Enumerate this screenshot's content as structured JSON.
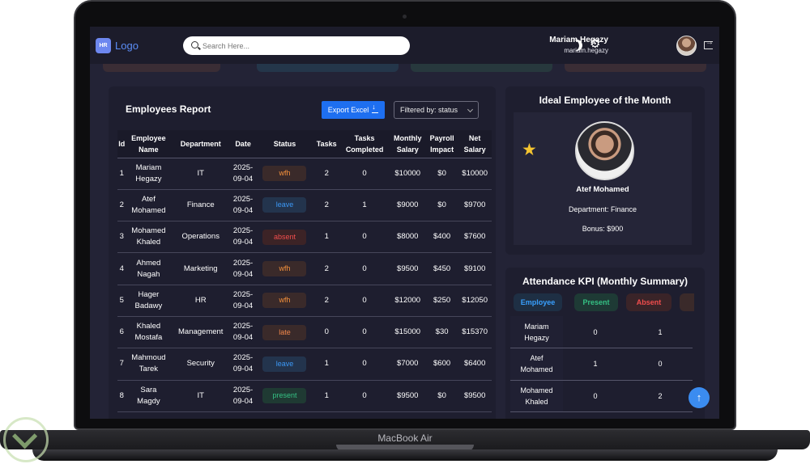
{
  "app": {
    "logo_badge": "HR",
    "logo_text": "Logo",
    "search_placeholder": "Search Here...",
    "user_name": "Mariam Hegazy",
    "user_email": "mariam.hegazy",
    "device_label": "MacBook Air"
  },
  "colors": {
    "accent": "#1e6ff0",
    "background": "#232336",
    "card": "#1e1e2f"
  },
  "report": {
    "title": "Employees Report",
    "export_label": "Export Excel",
    "filter_label": "Filtered by: status",
    "columns": [
      [
        "Id"
      ],
      [
        "Employee",
        "Name"
      ],
      [
        "Department"
      ],
      [
        "Date"
      ],
      [
        "Status"
      ],
      [
        "Tasks"
      ],
      [
        "Tasks",
        "Completed"
      ],
      [
        "Monthly",
        "Salary"
      ],
      [
        "Payroll",
        "Impact"
      ],
      [
        "Net",
        "Salary"
      ]
    ],
    "rows": [
      {
        "id": "1",
        "name": [
          "Mariam",
          "Hegazy"
        ],
        "dept": "IT",
        "date": [
          "2025-",
          "09-04"
        ],
        "status": "wfh",
        "tasks": "2",
        "done": "0",
        "salary": "$10000",
        "impact": "$0",
        "net": "$10000"
      },
      {
        "id": "2",
        "name": [
          "Atef",
          "Mohamed"
        ],
        "dept": "Finance",
        "date": [
          "2025-",
          "09-04"
        ],
        "status": "leave",
        "tasks": "2",
        "done": "1",
        "salary": "$9000",
        "impact": "$0",
        "net": "$9700"
      },
      {
        "id": "3",
        "name": [
          "Mohamed",
          "Khaled"
        ],
        "dept": "Operations",
        "date": [
          "2025-",
          "09-04"
        ],
        "status": "absent",
        "tasks": "1",
        "done": "0",
        "salary": "$8000",
        "impact": "$400",
        "net": "$7600"
      },
      {
        "id": "4",
        "name": [
          "Ahmed",
          "Nagah"
        ],
        "dept": "Marketing",
        "date": [
          "2025-",
          "09-04"
        ],
        "status": "wfh",
        "tasks": "2",
        "done": "0",
        "salary": "$9500",
        "impact": "$450",
        "net": "$9100"
      },
      {
        "id": "5",
        "name": [
          "Hager",
          "Badawy"
        ],
        "dept": "HR",
        "date": [
          "2025-",
          "09-04"
        ],
        "status": "wfh",
        "tasks": "2",
        "done": "0",
        "salary": "$12000",
        "impact": "$250",
        "net": "$12050"
      },
      {
        "id": "6",
        "name": [
          "Khaled",
          "Mostafa"
        ],
        "dept": "Management",
        "date": [
          "2025-",
          "09-04"
        ],
        "status": "late",
        "tasks": "0",
        "done": "0",
        "salary": "$15000",
        "impact": "$30",
        "net": "$15370"
      },
      {
        "id": "7",
        "name": [
          "Mahmoud",
          "Tarek"
        ],
        "dept": "Security",
        "date": [
          "2025-",
          "09-04"
        ],
        "status": "leave",
        "tasks": "1",
        "done": "0",
        "salary": "$7000",
        "impact": "$600",
        "net": "$6400"
      },
      {
        "id": "8",
        "name": [
          "Sara",
          "Magdy"
        ],
        "dept": "IT",
        "date": [
          "2025-",
          "09-04"
        ],
        "status": "present",
        "tasks": "1",
        "done": "0",
        "salary": "$9500",
        "impact": "$0",
        "net": "$9500"
      }
    ]
  },
  "ideal": {
    "title": "Ideal Employee of the Month",
    "name": "Atef Mohamed",
    "department": "Department: Finance",
    "bonus": "Bonus: $900"
  },
  "attendance": {
    "title": "Attendance KPI (Monthly Summary)",
    "headers": [
      "Employee",
      "Present",
      "Absent"
    ],
    "rows": [
      {
        "name": [
          "Mariam",
          "Hegazy"
        ],
        "present": "0",
        "absent": "1"
      },
      {
        "name": [
          "Atef",
          "Mohamed"
        ],
        "present": "1",
        "absent": "0"
      },
      {
        "name": [
          "Mohamed",
          "Khaled"
        ],
        "present": "0",
        "absent": "2"
      }
    ]
  }
}
